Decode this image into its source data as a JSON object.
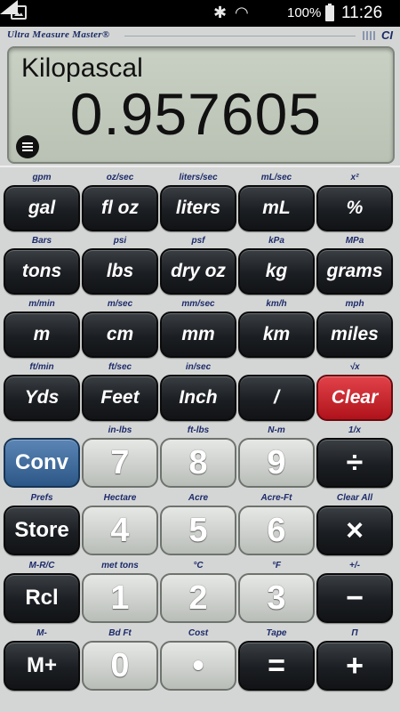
{
  "status_bar": {
    "battery": "100%",
    "time": "11:26"
  },
  "header": {
    "brand": "Ultra Measure Master®",
    "logo": "CI"
  },
  "display": {
    "unit": "Kilopascal",
    "value": "0.957605"
  },
  "keys": {
    "r1": [
      {
        "alt": "gpm",
        "label": "gal"
      },
      {
        "alt": "oz/sec",
        "label": "fl oz"
      },
      {
        "alt": "liters/sec",
        "label": "liters"
      },
      {
        "alt": "mL/sec",
        "label": "mL"
      },
      {
        "alt": "x²",
        "label": "%"
      }
    ],
    "r2": [
      {
        "alt": "Bars",
        "label": "tons"
      },
      {
        "alt": "psi",
        "label": "lbs"
      },
      {
        "alt": "psf",
        "label": "dry oz"
      },
      {
        "alt": "kPa",
        "label": "kg"
      },
      {
        "alt": "MPa",
        "label": "grams"
      }
    ],
    "r3": [
      {
        "alt": "m/min",
        "label": "m"
      },
      {
        "alt": "m/sec",
        "label": "cm"
      },
      {
        "alt": "mm/sec",
        "label": "mm"
      },
      {
        "alt": "km/h",
        "label": "km"
      },
      {
        "alt": "mph",
        "label": "miles"
      }
    ],
    "r4": [
      {
        "alt": "ft/min",
        "label": "Yds"
      },
      {
        "alt": "ft/sec",
        "label": "Feet"
      },
      {
        "alt": "in/sec",
        "label": "Inch"
      },
      {
        "alt": "",
        "label": "/"
      },
      {
        "alt": "√x",
        "label": "Clear"
      }
    ],
    "r5": [
      {
        "alt": "",
        "label": "Conv"
      },
      {
        "alt": "in-lbs",
        "label": "7"
      },
      {
        "alt": "ft-lbs",
        "label": "8"
      },
      {
        "alt": "N-m",
        "label": "9"
      },
      {
        "alt": "1/x",
        "label": "÷"
      }
    ],
    "r6": [
      {
        "alt": "Prefs",
        "label": "Store"
      },
      {
        "alt": "Hectare",
        "label": "4"
      },
      {
        "alt": "Acre",
        "label": "5"
      },
      {
        "alt": "Acre-Ft",
        "label": "6"
      },
      {
        "alt": "Clear All",
        "label": "×"
      }
    ],
    "r7": [
      {
        "alt": "M-R/C",
        "label": "Rcl"
      },
      {
        "alt": "met tons",
        "label": "1"
      },
      {
        "alt": "°C",
        "label": "2"
      },
      {
        "alt": "°F",
        "label": "3"
      },
      {
        "alt": "+/-",
        "label": "−"
      }
    ],
    "r8": [
      {
        "alt": "M-",
        "label": "M+"
      },
      {
        "alt": "Bd Ft",
        "label": "0"
      },
      {
        "alt": "Cost",
        "label": "•"
      },
      {
        "alt": "Tape",
        "label": "="
      },
      {
        "alt": "Π",
        "label": "+"
      }
    ]
  }
}
